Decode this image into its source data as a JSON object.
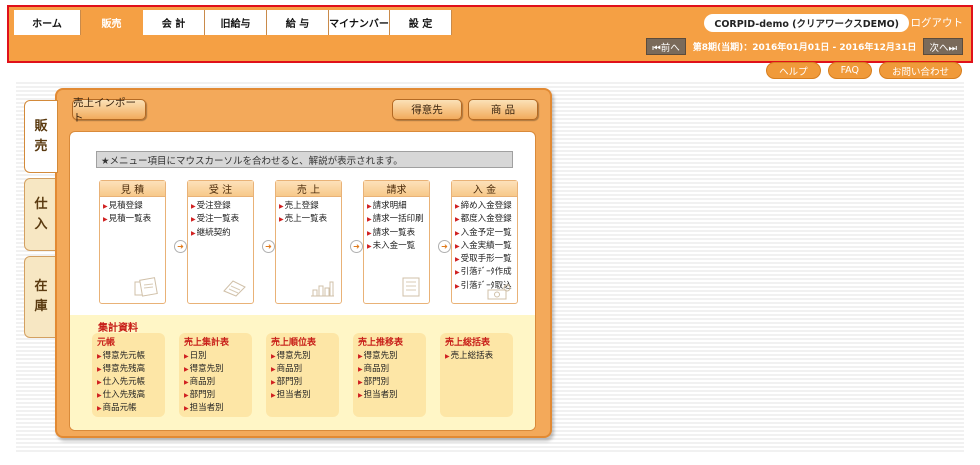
{
  "header": {
    "tabs": [
      {
        "label": "ホーム",
        "active": false
      },
      {
        "label": "販売",
        "active": true
      },
      {
        "label": "会 計",
        "active": false
      },
      {
        "label": "旧給与",
        "active": false
      },
      {
        "label": "給 与",
        "active": false
      },
      {
        "label": "マイナンバー",
        "active": false
      },
      {
        "label": "設 定",
        "active": false
      }
    ],
    "company": "CORPID-demo (クリアワークスDEMO)",
    "logout": "ログアウト",
    "prev": "⏮前へ",
    "period": "第8期(当期)：2016年01月01日 - 2016年12月31日",
    "next": "次へ⏭"
  },
  "help_links": [
    "ヘルプ",
    "FAQ",
    "お問い合わせ"
  ],
  "side_tabs": [
    {
      "label": [
        "販",
        "売"
      ],
      "active": true
    },
    {
      "label": [
        "仕",
        "入"
      ],
      "active": false
    },
    {
      "label": [
        "在",
        "庫"
      ],
      "active": false
    }
  ],
  "panel": {
    "import_button": "売上インポート",
    "customer_button": "得意先",
    "product_button": "商 品",
    "notice": "★メニュー項目にマウスカーソルを合わせると、解説が表示されます。"
  },
  "cards": [
    {
      "title": "見 積",
      "items": [
        "見積登録",
        "見積一覧表"
      ],
      "icon": "documents-icon"
    },
    {
      "title": "受 注",
      "items": [
        "受注登録",
        "受注一覧表",
        "継続契約"
      ],
      "icon": "fax-icon"
    },
    {
      "title": "売 上",
      "items": [
        "売上登録",
        "売上一覧表"
      ],
      "icon": "bar-chart-icon"
    },
    {
      "title": "請求",
      "items": [
        "請求明細",
        "請求一括印刷",
        "請求一覧表",
        "未入金一覧"
      ],
      "icon": "invoice-icon"
    },
    {
      "title": "入 金",
      "items": [
        "締め入金登録",
        "都度入金登録",
        "入金予定一覧",
        "入金実績一覧",
        "受取手形一覧",
        "引落ﾃﾞｰﾀ作成",
        "引落ﾃﾞｰﾀ取込"
      ],
      "icon": "money-icon"
    }
  ],
  "summary": {
    "title": "集計資料",
    "groups": [
      {
        "title": "元帳",
        "items": [
          "得意先元帳",
          "得意先残高",
          "仕入先元帳",
          "仕入先残高",
          "商品元帳"
        ]
      },
      {
        "title": "売上集計表",
        "items": [
          "日別",
          "得意先別",
          "商品別",
          "部門別",
          "担当者別"
        ]
      },
      {
        "title": "売上順位表",
        "items": [
          "得意先別",
          "商品別",
          "部門別",
          "担当者別"
        ]
      },
      {
        "title": "売上推移表",
        "items": [
          "得意先別",
          "商品別",
          "部門別",
          "担当者別"
        ]
      },
      {
        "title": "売上総括表",
        "items": [
          "売上総括表"
        ]
      }
    ]
  },
  "colors": {
    "brand_orange": "#f5a044",
    "highlight_border": "#e0101a",
    "link_red": "#c8201a"
  }
}
